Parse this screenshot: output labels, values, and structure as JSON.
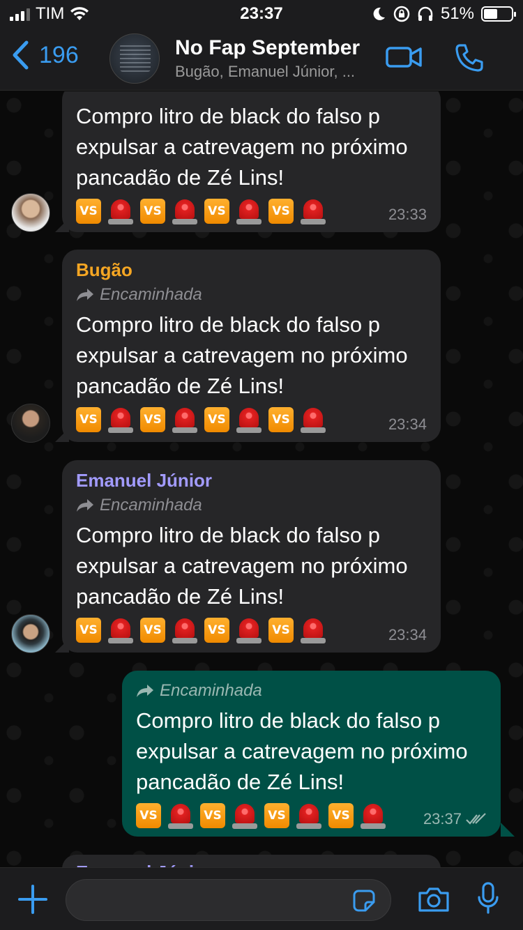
{
  "status_bar": {
    "carrier": "TIM",
    "time": "23:37",
    "battery": "51%",
    "battery_level": 0.51
  },
  "header": {
    "back_count": "196",
    "title": "No Fap September",
    "subtitle": "Bugão, Emanuel Júnior, ...",
    "icons": [
      "video-call-icon",
      "phone-call-icon"
    ]
  },
  "messages": [
    {
      "direction": "in",
      "text": "Compro litro de black do falso p expulsar a catrevagem no próximo pancadão de Zé Lins!",
      "time": "23:33"
    },
    {
      "direction": "in",
      "sender": "Bugão",
      "sender_color": "#f5a623",
      "forwarded": "Encaminhada",
      "text": "Compro litro de black do falso p expulsar a catrevagem no próximo pancadão de Zé Lins!",
      "time": "23:34"
    },
    {
      "direction": "in",
      "sender": "Emanuel Júnior",
      "sender_color": "#a29bfe",
      "forwarded": "Encaminhada",
      "text": "Compro litro de black do falso p expulsar a catrevagem no próximo pancadão de Zé Lins!",
      "time": "23:34"
    },
    {
      "direction": "out",
      "forwarded": "Encaminhada",
      "text": "Compro litro de black do falso p expulsar a catrevagem no próximo pancadão de Zé Lins!",
      "time": "23:37",
      "status": "read"
    }
  ],
  "emoji": {
    "vs": "VS",
    "pattern": [
      "vs-button",
      "police-siren",
      "vs-button",
      "police-siren",
      "vs-button",
      "police-siren",
      "vs-button",
      "police-siren"
    ]
  },
  "composer": {
    "placeholder": "",
    "icons": [
      "plus-icon",
      "sticker-icon",
      "camera-icon",
      "microphone-icon"
    ]
  },
  "colors": {
    "accent": "#3a9cf0",
    "incoming_bubble": "#262628",
    "outgoing_bubble": "#005046"
  }
}
